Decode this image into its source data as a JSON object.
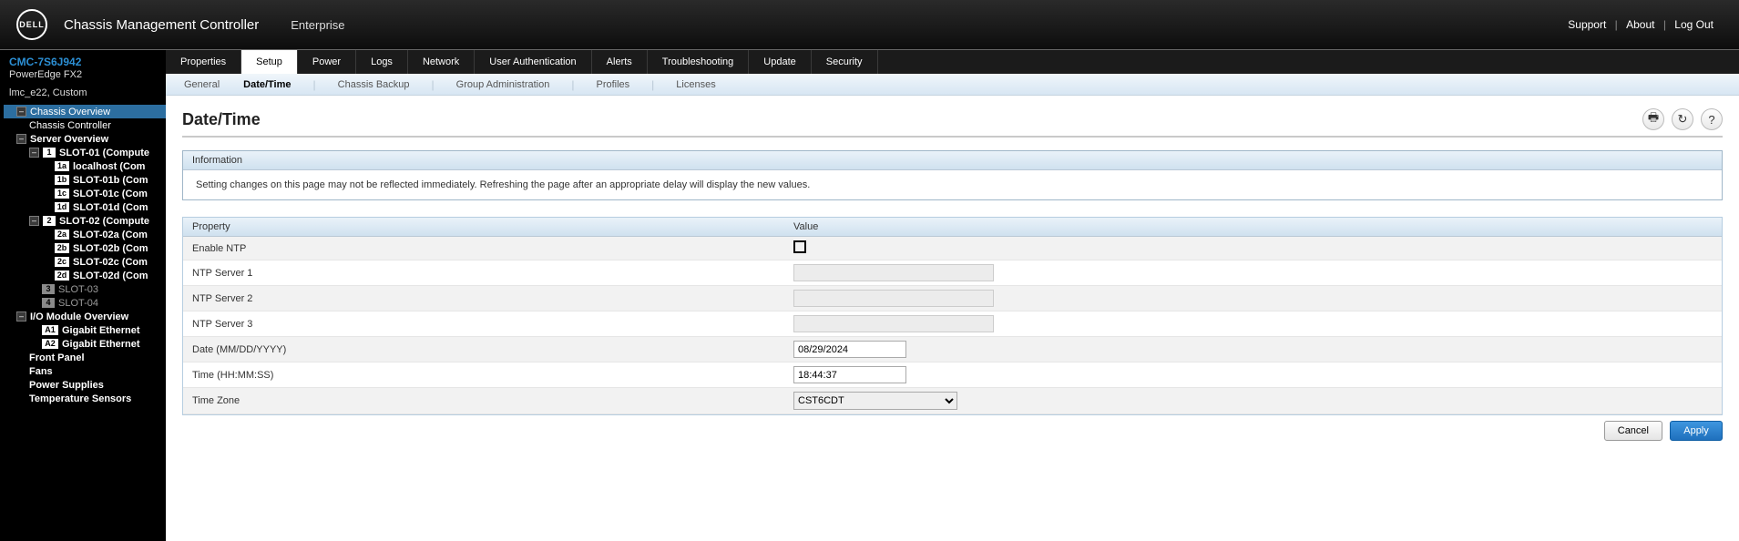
{
  "header": {
    "brand_text": "DELL",
    "app_title": "Chassis Management Controller",
    "context": "Enterprise",
    "links": {
      "support": "Support",
      "about": "About",
      "logout": "Log Out"
    }
  },
  "system": {
    "id": "CMC-7S6J942",
    "model": "PowerEdge FX2",
    "name": "lmc_e22, Custom"
  },
  "tree": {
    "chassis_overview": "Chassis Overview",
    "chassis_controller": "Chassis Controller",
    "server_overview": "Server Overview",
    "slot01": {
      "num": "1",
      "label": "SLOT-01 (Compute",
      "children": [
        {
          "id": "1a",
          "label": "localhost (Com"
        },
        {
          "id": "1b",
          "label": "SLOT-01b (Com"
        },
        {
          "id": "1c",
          "label": "SLOT-01c (Com"
        },
        {
          "id": "1d",
          "label": "SLOT-01d (Com"
        }
      ]
    },
    "slot02": {
      "num": "2",
      "label": "SLOT-02 (Compute",
      "children": [
        {
          "id": "2a",
          "label": "SLOT-02a (Com"
        },
        {
          "id": "2b",
          "label": "SLOT-02b (Com"
        },
        {
          "id": "2c",
          "label": "SLOT-02c (Com"
        },
        {
          "id": "2d",
          "label": "SLOT-02d (Com"
        }
      ]
    },
    "slot03": {
      "num": "3",
      "label": "SLOT-03"
    },
    "slot04": {
      "num": "4",
      "label": "SLOT-04"
    },
    "io_overview": "I/O Module Overview",
    "io_a1": {
      "id": "A1",
      "label": "Gigabit Ethernet"
    },
    "io_a2": {
      "id": "A2",
      "label": "Gigabit Ethernet"
    },
    "front_panel": "Front Panel",
    "fans": "Fans",
    "power_supplies": "Power Supplies",
    "temp_sensors": "Temperature Sensors"
  },
  "tabs1": [
    "Properties",
    "Setup",
    "Power",
    "Logs",
    "Network",
    "User Authentication",
    "Alerts",
    "Troubleshooting",
    "Update",
    "Security"
  ],
  "tabs1_active": 1,
  "tabs2": [
    "General",
    "Date/Time",
    "Chassis Backup",
    "Group Administration",
    "Profiles",
    "Licenses"
  ],
  "tabs2_active": 1,
  "page": {
    "title": "Date/Time",
    "info_header": "Information",
    "info_body": "Setting changes on this page may not be reflected immediately. Refreshing the page after an appropriate delay will display the new values.",
    "prop_header": "Property",
    "val_header": "Value",
    "rows": {
      "enable_ntp": "Enable NTP",
      "ntp1": "NTP Server 1",
      "ntp2": "NTP Server 2",
      "ntp3": "NTP Server 3",
      "date": "Date (MM/DD/YYYY)",
      "time": "Time (HH:MM:SS)",
      "tz": "Time Zone"
    },
    "values": {
      "enable_ntp": false,
      "ntp1": "",
      "ntp2": "",
      "ntp3": "",
      "date": "08/29/2024",
      "time": "18:44:37",
      "tz": "CST6CDT"
    },
    "buttons": {
      "cancel": "Cancel",
      "apply": "Apply"
    }
  }
}
